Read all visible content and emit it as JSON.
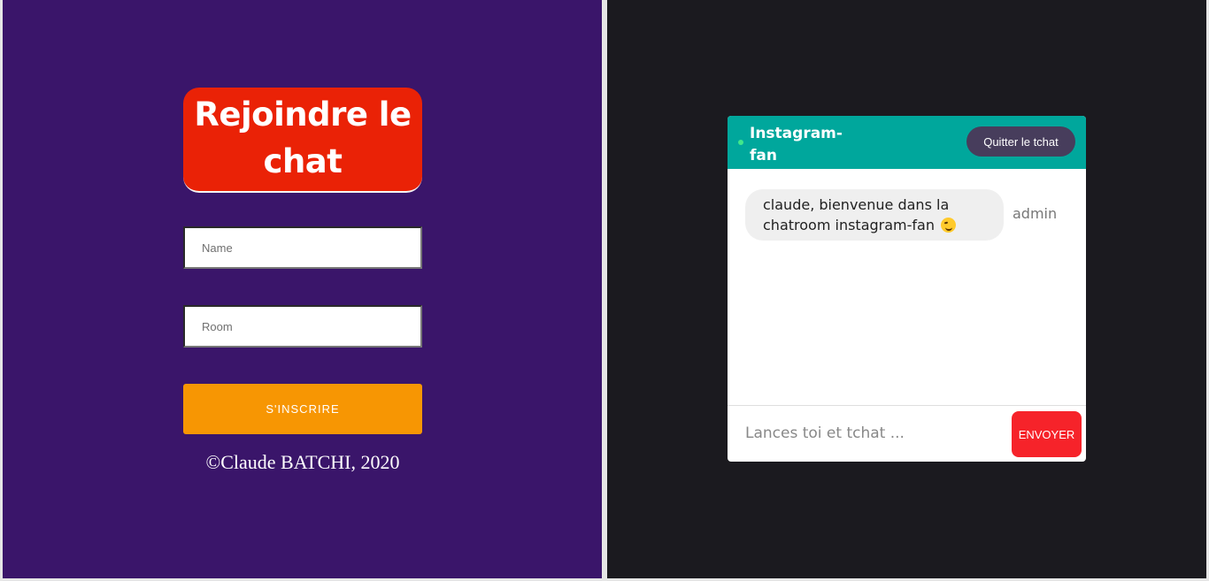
{
  "join_form": {
    "title": "Rejoindre le chat",
    "name_placeholder": "Name",
    "room_placeholder": "Room",
    "signup_button": "S'INSCRIRE",
    "copyright": "©Claude BATCHI, 2020"
  },
  "chat": {
    "room_name": "Instagram-fan",
    "quit_button": "Quitter le tchat",
    "messages": [
      {
        "text": "claude, bienvenue dans la chatroom instagram-fan",
        "sender": "admin"
      }
    ],
    "input_placeholder": "Lances toi et tchat ...",
    "send_button": "ENVOYER"
  },
  "colors": {
    "left_background": "#3a156a",
    "right_background": "#1b1a1f",
    "title_background": "#ea2206",
    "signup_button": "#f79603",
    "chat_header": "#00a79c",
    "quit_button": "#473d5c",
    "send_button": "#f6232a"
  },
  "icons": {
    "online_status": "online-dot-icon",
    "emoji": "winking-face-icon"
  }
}
